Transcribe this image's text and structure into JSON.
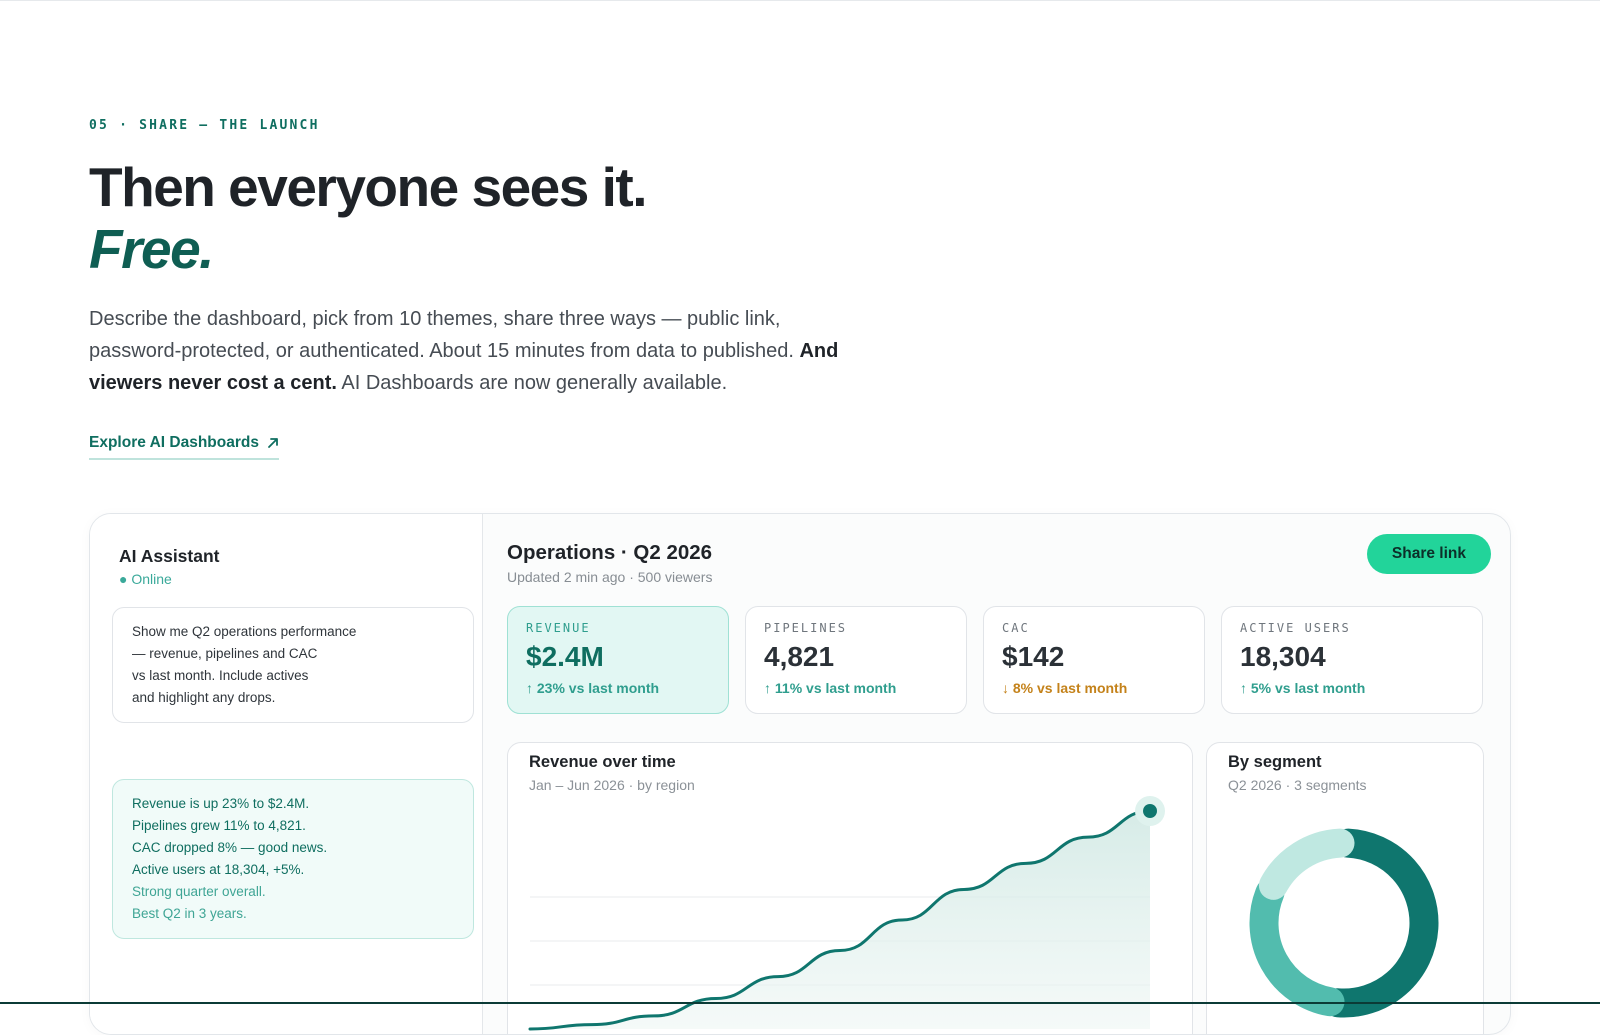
{
  "hero": {
    "eyebrow": "05 · SHARE — THE LAUNCH",
    "headline": "Then everyone sees it.",
    "headline_accent": "Free.",
    "lede_start": "Describe the dashboard, pick from 10 themes, share three ways — public link, password-protected, or authenticated. About 15 minutes from data to published. ",
    "lede_bold": "And viewers never cost a cent.",
    "lede_end": " AI Dashboards are now generally available.",
    "cta_label": "Explore AI Dashboards",
    "cta_icon": "arrow-up-right-icon"
  },
  "assistant": {
    "title": "AI Assistant",
    "status": "● Online",
    "user_message": [
      "Show me Q2 operations performance",
      "— revenue, pipelines and CAC",
      "vs last month. Include actives",
      "and highlight any drops."
    ],
    "ai_message": [
      "Revenue is up 23% to $2.4M.",
      "Pipelines grew 11% to 4,821.",
      "CAC dropped 8% — good news.",
      "Active users at 18,304, +5%."
    ],
    "ai_message_soft": [
      "Strong quarter overall.",
      "Best Q2 in 3 years."
    ]
  },
  "dashboard": {
    "title": "Operations · Q2 2026",
    "subtitle": "Updated 2 min ago · 500 viewers",
    "share_label": "Share link",
    "kpis": [
      {
        "label": "REVENUE",
        "value": "$2.4M",
        "delta": "↑ 23% vs last month",
        "direction": "up"
      },
      {
        "label": "PIPELINES",
        "value": "4,821",
        "delta": "↑ 11% vs last month",
        "direction": "up"
      },
      {
        "label": "CAC",
        "value": "$142",
        "delta": "↓ 8% vs last month",
        "direction": "down"
      },
      {
        "label": "ACTIVE USERS",
        "value": "18,304",
        "delta": "↑ 5% vs last month",
        "direction": "up"
      }
    ]
  },
  "chart_data": [
    {
      "type": "area",
      "title": "Revenue over time",
      "subtitle": "Jan – Jun 2026 · by region",
      "x": [
        0,
        1,
        2,
        3,
        4,
        5,
        6,
        7,
        8,
        9,
        10
      ],
      "values": [
        0,
        2,
        6,
        14,
        24,
        36,
        50,
        64,
        76,
        88,
        100
      ],
      "ylim": [
        0,
        100
      ],
      "grid": true,
      "line_color": "#0f766e"
    },
    {
      "type": "pie",
      "title": "By segment",
      "subtitle": "Q2 2026 · 3 segments",
      "values": [
        52,
        30,
        18
      ],
      "colors": [
        "#0f766e",
        "#52bcae",
        "#bfe8e1"
      ]
    }
  ],
  "colors": {
    "accent": "#0f6e60",
    "share_button": "#22d49a",
    "positive": "#2f9e8e",
    "negative": "#c4821a"
  }
}
